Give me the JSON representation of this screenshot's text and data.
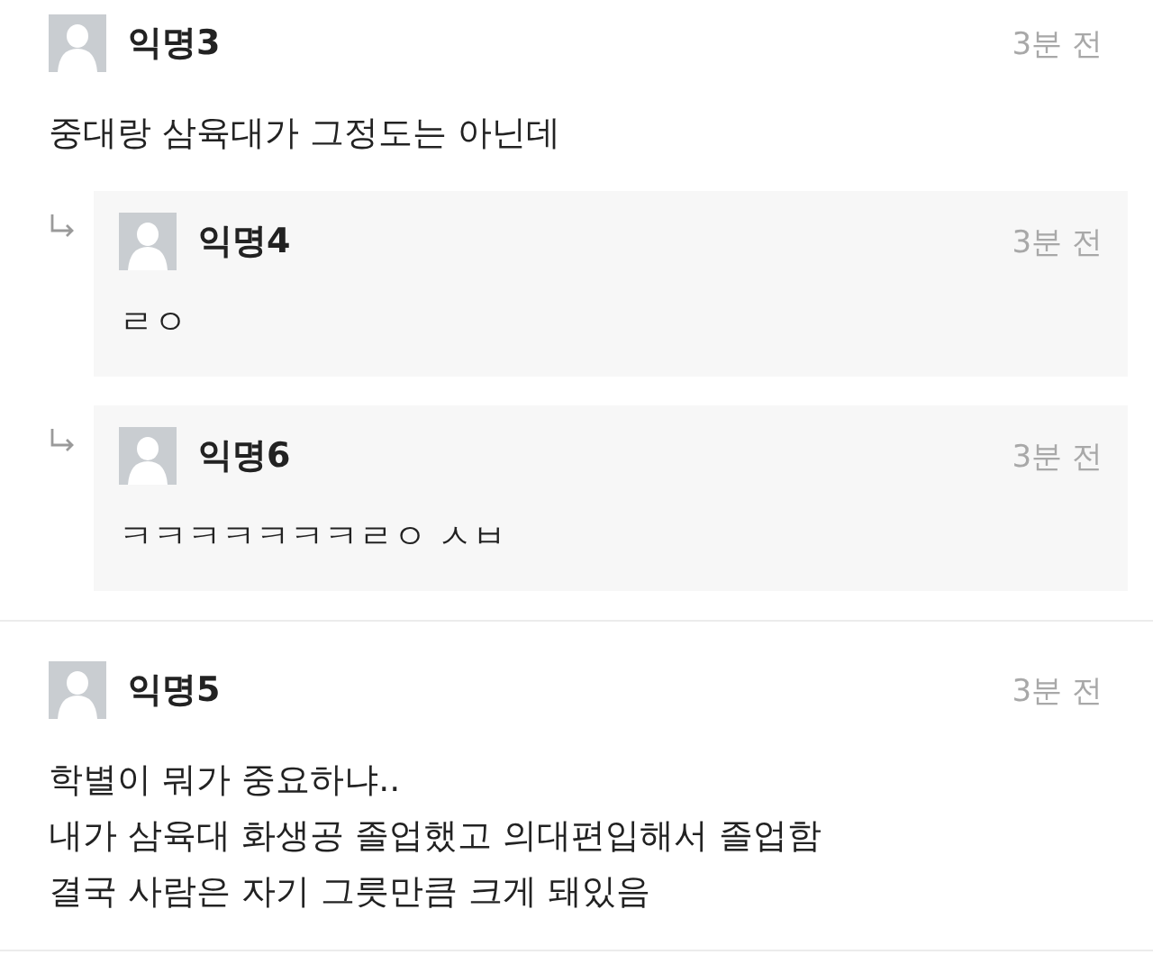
{
  "comments": [
    {
      "name": "익명3",
      "time": "3분 전",
      "text": "중대랑 삼육대가 그정도는 아닌데",
      "replies": [
        {
          "name": "익명4",
          "time": "3분 전",
          "text": "ㄹㅇ"
        },
        {
          "name": "익명6",
          "time": "3분 전",
          "text": "ㅋㅋㅋㅋㅋㅋㅋㄹㅇ ㅅㅂ"
        }
      ]
    },
    {
      "name": "익명5",
      "time": "3분 전",
      "text": "학별이 뭐가 중요하냐..\n내가 삼육대 화생공 졸업했고 의대편입해서 졸업함\n결국 사람은 자기 그릇만큼 크게 돼있음"
    }
  ]
}
